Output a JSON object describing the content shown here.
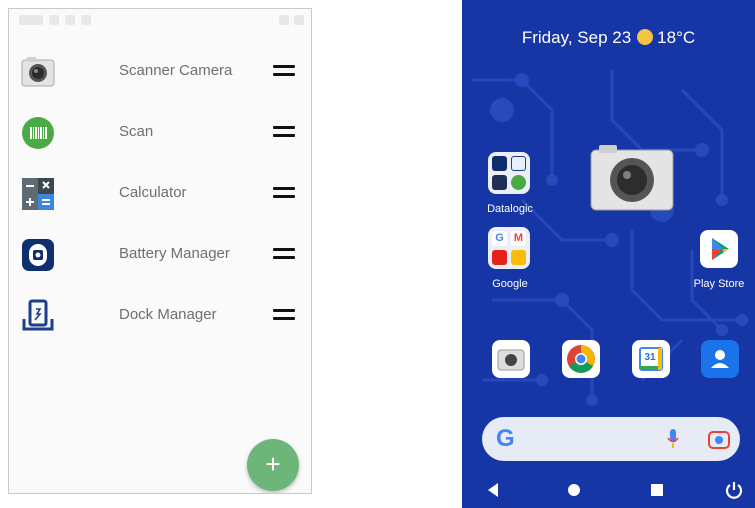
{
  "left_panel": {
    "apps": [
      {
        "name": "Scanner Camera",
        "icon": "camera-icon"
      },
      {
        "name": "Scan",
        "icon": "barcode-icon"
      },
      {
        "name": "Calculator",
        "icon": "calculator-icon"
      },
      {
        "name": "Battery Manager",
        "icon": "battery-manager-icon"
      },
      {
        "name": "Dock Manager",
        "icon": "dock-manager-icon"
      }
    ],
    "fab_label": "+",
    "fab_color": "#6db67a"
  },
  "right_panel": {
    "date": "Friday, Sep 23",
    "temperature": "18°C",
    "wallpaper_color": "#1636a6",
    "folders": [
      {
        "label": "Datalogic"
      },
      {
        "label": "Google"
      }
    ],
    "play_store_label": "Play Store",
    "dock_apps": [
      "camera-icon",
      "chrome-icon",
      "calendar-icon",
      "contacts-icon"
    ],
    "calendar_day": "31",
    "search": {
      "logo": "G"
    }
  }
}
